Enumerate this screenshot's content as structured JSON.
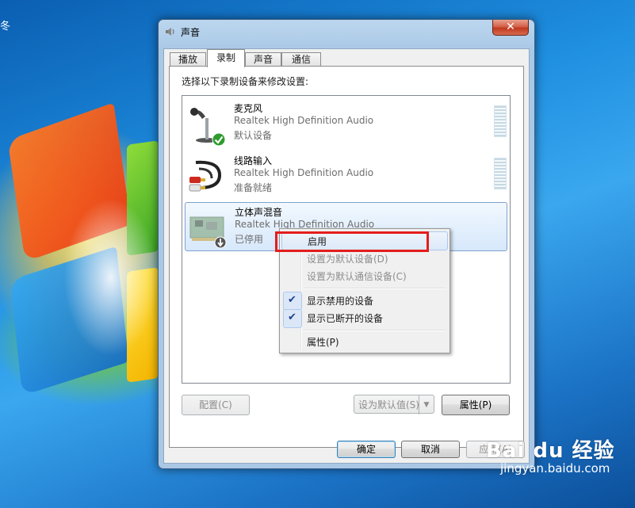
{
  "window": {
    "title": "声音",
    "close_glyph": "✕"
  },
  "tabs": [
    {
      "label": "播放",
      "active": false
    },
    {
      "label": "录制",
      "active": true
    },
    {
      "label": "声音",
      "active": false
    },
    {
      "label": "通信",
      "active": false
    }
  ],
  "panel": {
    "prompt": "选择以下录制设备来修改设置:"
  },
  "devices": [
    {
      "name": "麦克风",
      "driver": "Realtek High Definition Audio",
      "status": "默认设备",
      "icon": "microphone-icon",
      "badge": "default-check-icon",
      "selected": false
    },
    {
      "name": "线路输入",
      "driver": "Realtek High Definition Audio",
      "status": "准备就绪",
      "icon": "audio-cable-icon",
      "badge": "",
      "selected": false
    },
    {
      "name": "立体声混音",
      "driver": "Realtek High Definition Audio",
      "status": "已停用",
      "icon": "sound-card-icon",
      "badge": "disabled-arrow-icon",
      "selected": true
    }
  ],
  "panel_buttons": {
    "configure": "配置(C)",
    "set_default": "设为默认值(S)",
    "properties": "属性(P)"
  },
  "dialog_buttons": {
    "ok": "确定",
    "cancel": "取消",
    "apply": "应用(A)"
  },
  "context_menu": {
    "items": [
      {
        "label": "启用",
        "enabled": true,
        "checked": false
      },
      {
        "label": "设置为默认设备(D)",
        "enabled": false,
        "checked": false
      },
      {
        "label": "设置为默认通信设备(C)",
        "enabled": false,
        "checked": false
      },
      {
        "label": "显示禁用的设备",
        "enabled": true,
        "checked": true
      },
      {
        "label": "显示已断开的设备",
        "enabled": true,
        "checked": true
      },
      {
        "label": "属性(P)",
        "enabled": true,
        "checked": false
      }
    ],
    "check_glyph": "✔"
  },
  "colors": {
    "highlight_border": "#e41d1d",
    "selection_fill": "#d6e8fb",
    "close_button": "#c0391f"
  },
  "desktop": {
    "fragment": "冬"
  },
  "watermark": {
    "brand": "Bai du 经验",
    "url": "jingyan.baidu.com"
  }
}
